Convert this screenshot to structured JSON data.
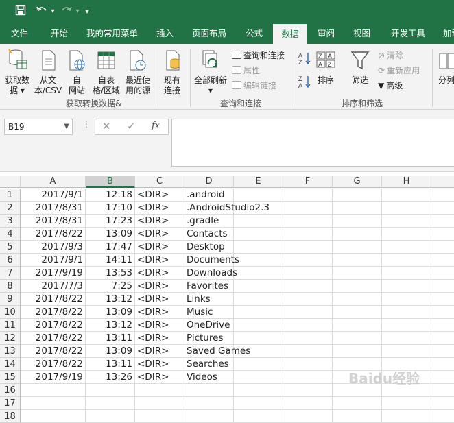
{
  "quick_access": {
    "save_icon": "save-icon",
    "undo_icon": "undo-icon",
    "redo_icon": "redo-icon",
    "customize": "▾"
  },
  "tabs": [
    "文件",
    "开始",
    "我的常用菜单",
    "插入",
    "页面布局",
    "公式",
    "数据",
    "审阅",
    "视图",
    "开发工具",
    "加载"
  ],
  "active_tab": "数据",
  "ribbon": {
    "get_transform": {
      "label": "获取转换数据&",
      "get_data": [
        "获取数",
        "据"
      ],
      "from_text": [
        "从文",
        "本/CSV"
      ],
      "from_web": [
        "自",
        "网站"
      ],
      "from_table": [
        "自表",
        "格/区域"
      ],
      "recent_sources": [
        "最近使",
        "用的源"
      ],
      "existing": [
        "现有",
        "连接"
      ]
    },
    "queries": {
      "label": "查询和连接",
      "refresh_all": [
        "全部刷新"
      ],
      "queries_connections": "查询和连接",
      "properties": "属性",
      "edit_links": "编辑链接"
    },
    "sort_filter": {
      "label": "排序和筛选",
      "sort": "排序",
      "filter": "筛选",
      "clear": "清除",
      "reapply": "重新应用",
      "advanced": "高级",
      "split": "分列"
    }
  },
  "formula_bar": {
    "name_box": "B19",
    "fx": "fx",
    "value": ""
  },
  "columns": [
    "A",
    "B",
    "C",
    "D",
    "E",
    "F",
    "G",
    "H"
  ],
  "selected_column": "B",
  "rows": [
    {
      "n": "1",
      "date": "2017/9/1",
      "time": "12:18",
      "type": "<DIR>",
      "name": ".android"
    },
    {
      "n": "2",
      "date": "2017/8/31",
      "time": "17:10",
      "type": "<DIR>",
      "name": ".AndroidStudio2.3"
    },
    {
      "n": "3",
      "date": "2017/8/31",
      "time": "17:23",
      "type": "<DIR>",
      "name": ".gradle"
    },
    {
      "n": "4",
      "date": "2017/8/22",
      "time": "13:09",
      "type": "<DIR>",
      "name": "Contacts"
    },
    {
      "n": "5",
      "date": "2017/9/3",
      "time": "17:47",
      "type": "<DIR>",
      "name": "Desktop"
    },
    {
      "n": "6",
      "date": "2017/9/1",
      "time": "14:11",
      "type": "<DIR>",
      "name": "Documents"
    },
    {
      "n": "7",
      "date": "2017/9/19",
      "time": "13:53",
      "type": "<DIR>",
      "name": "Downloads"
    },
    {
      "n": "8",
      "date": "2017/7/3",
      "time": "7:25",
      "type": "<DIR>",
      "name": "Favorites"
    },
    {
      "n": "9",
      "date": "2017/8/22",
      "time": "13:12",
      "type": "<DIR>",
      "name": "Links"
    },
    {
      "n": "10",
      "date": "2017/8/22",
      "time": "13:09",
      "type": "<DIR>",
      "name": "Music"
    },
    {
      "n": "11",
      "date": "2017/8/22",
      "time": "13:12",
      "type": "<DIR>",
      "name": "OneDrive"
    },
    {
      "n": "12",
      "date": "2017/8/22",
      "time": "13:11",
      "type": "<DIR>",
      "name": "Pictures"
    },
    {
      "n": "13",
      "date": "2017/8/22",
      "time": "13:09",
      "type": "<DIR>",
      "name": "Saved Games"
    },
    {
      "n": "14",
      "date": "2017/8/22",
      "time": "13:11",
      "type": "<DIR>",
      "name": "Searches"
    },
    {
      "n": "15",
      "date": "2017/9/19",
      "time": "13:26",
      "type": "<DIR>",
      "name": "Videos"
    },
    {
      "n": "16",
      "date": "",
      "time": "",
      "type": "",
      "name": ""
    },
    {
      "n": "17",
      "date": "",
      "time": "",
      "type": "",
      "name": ""
    },
    {
      "n": "18",
      "date": "",
      "time": "",
      "type": "",
      "name": ""
    }
  ],
  "watermark": "Baidu经验",
  "colors": {
    "excel_green": "#217346",
    "ribbon_bg": "#f3f3f3"
  }
}
